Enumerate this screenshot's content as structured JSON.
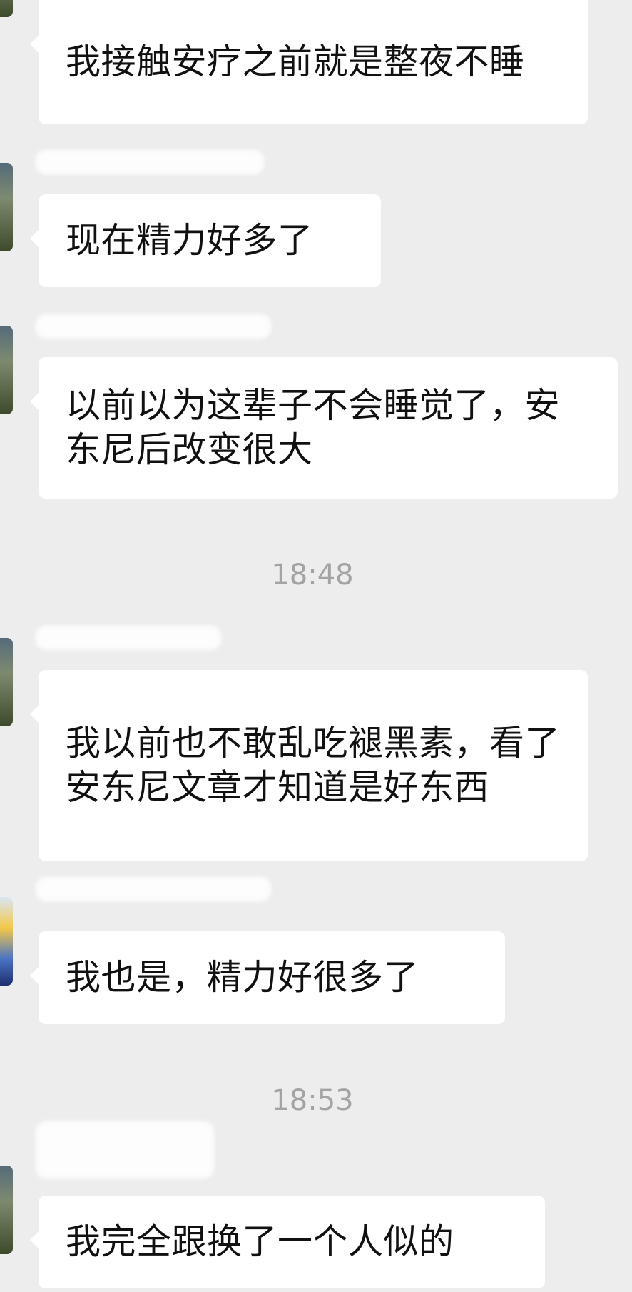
{
  "chat": {
    "messages": [
      {
        "text": "我接触安疗之前就是整夜不睡"
      },
      {
        "text": "现在精力好多了"
      },
      {
        "text": "以前以为这辈子不会睡觉了，安东尼后改变很大"
      },
      {
        "text": "我以前也不敢乱吃褪黑素，看了安东尼文章才知道是好东西"
      },
      {
        "text": "我也是，精力好很多了"
      },
      {
        "text": "我完全跟换了一个人似的"
      }
    ],
    "timestamps": [
      "18:48",
      "18:53"
    ]
  },
  "colors": {
    "background": "#ededed",
    "bubble": "#ffffff",
    "text": "#111111",
    "timestamp": "#a3a3a3"
  }
}
